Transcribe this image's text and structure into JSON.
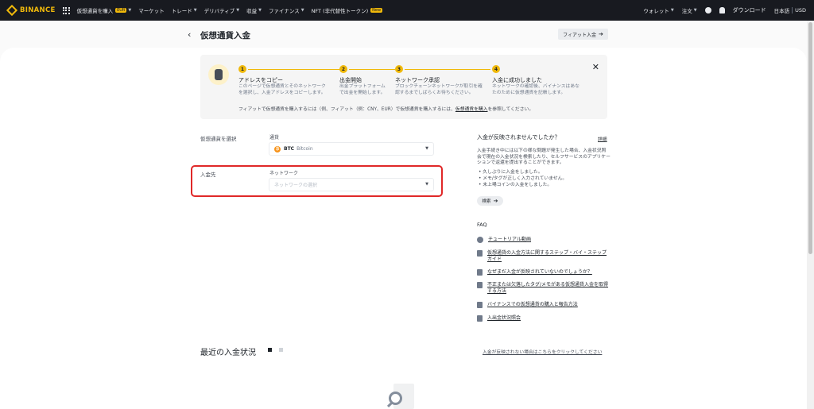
{
  "nav": {
    "brand": "BINANCE",
    "items": [
      {
        "label": "仮想通貨を購入",
        "badge": "EUR"
      },
      {
        "label": "マーケット"
      },
      {
        "label": "トレード"
      },
      {
        "label": "デリバティブ"
      },
      {
        "label": "収益"
      },
      {
        "label": "ファイナンス"
      },
      {
        "label": "NFT (非代替性トークン)",
        "badge": "New"
      }
    ],
    "wallet": "ウォレット",
    "orders": "注文",
    "download": "ダウンロード",
    "language": "日本語",
    "currency": "USD"
  },
  "page": {
    "title": "仮想通貨入金",
    "fiat_button": "フィアット入金"
  },
  "steps": [
    {
      "num": "1",
      "title": "アドレスをコピー",
      "desc": "このページで仮想通貨とそのネットワークを選択し、入金アドレスをコピーします。"
    },
    {
      "num": "2",
      "title": "出金開始",
      "desc": "出金プラットフォームで出金を開始します。"
    },
    {
      "num": "3",
      "title": "ネットワーク承認",
      "desc": "ブロックチェーンネットワークが取引を確認するまでしばらくお待ちください。"
    },
    {
      "num": "4",
      "title": "入金に成功しました",
      "desc": "ネットワークの確認後、バイナンスはあなたのために仮想通貨を記帳します。"
    }
  ],
  "fiat_note": {
    "text": "フィアットで仮想通貨を購入するには（例、フィアット（例：CNY、EUR）で仮想通貨を購入するには、",
    "link": "仮想通貨を購入",
    "suffix": "を参照してください。"
  },
  "form": {
    "select_coin_label": "仮想通貨を選択",
    "coin_field_label": "通貨",
    "coin_symbol": "BTC",
    "coin_name": "Bitcoin",
    "deposit_to_label": "入金先",
    "network_label": "ネットワーク",
    "network_placeholder": "ネットワークの選択"
  },
  "help": {
    "title": "入金が反映されませんでしたか？",
    "detail": "詳細",
    "text": "入金手続き中には以下の様な問題が発生した場合、入金状況照会で現在の入金状況を検索したり、セルフサービスのアプリケーションで返還を提出することができます。",
    "reasons": [
      "久しぶりに入金をしました。",
      "メモ/タグが正しく入力されていません。",
      "未上場コインの入金をしました。"
    ],
    "search_button": "検索"
  },
  "faq": {
    "title": "FAQ",
    "items": [
      "チュートリアル動画",
      "仮想通貨の入金方法に関するステップ・バイ・ステップガイド",
      "なぜまだ入金が反映されていないのでしょうか？",
      "不正または欠落したタグ/メモがある仮想通貨入金を取得する方法",
      "バイナンスでの仮想通貨の購入と報告方法",
      "入出金状況照会"
    ]
  },
  "recent": {
    "title": "最近の入金状況",
    "cant_find": "入金が反映されない場合はこちらをクリックしてください"
  },
  "colors": {
    "accent": "#f0b90b",
    "nav_bg": "#181a20",
    "highlight": "#e02828"
  }
}
